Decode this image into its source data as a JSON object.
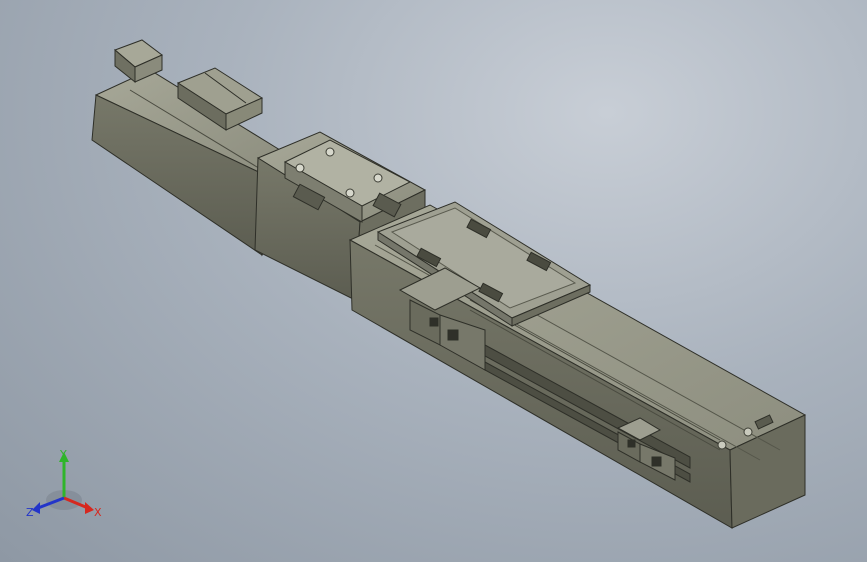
{
  "viewport": {
    "background_top": "#c8ced6",
    "background_bottom": "#8e98a4"
  },
  "model": {
    "name": "linear-actuator",
    "body_color": "#7a7b6c",
    "body_light": "#9b9c8c",
    "body_dark": "#5f6053",
    "edge_color": "#2e2f28",
    "carriage_plate_color": "#a3a496",
    "accent_color": "#3a6fc2"
  },
  "triad": {
    "x_label": "X",
    "y_label": "Y",
    "z_label": "Z",
    "x_color": "#d6281f",
    "y_color": "#2fb52a",
    "z_color": "#2335c9"
  }
}
